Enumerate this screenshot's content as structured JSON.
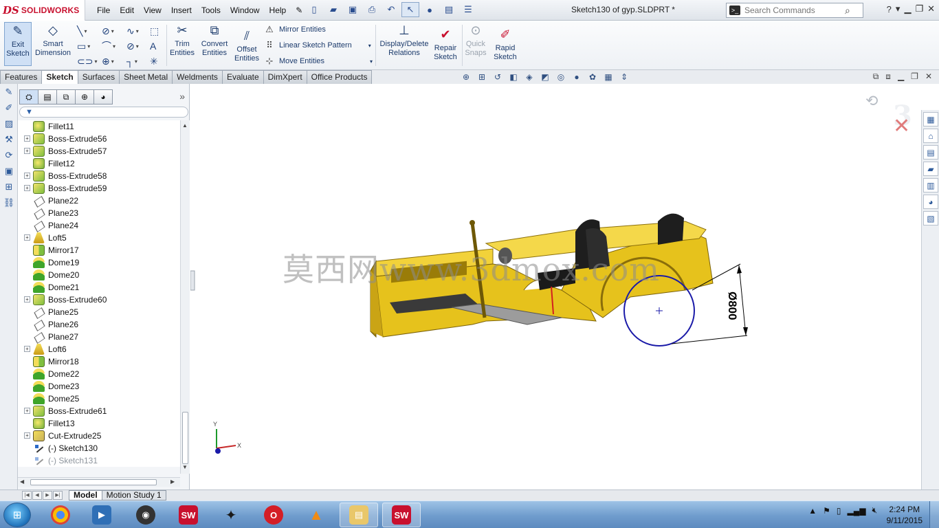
{
  "app": {
    "brand_mark": "DS",
    "brand_name": "SOLIDWORKS",
    "window_title": "Sketch130 of gyp.SLDPRT *"
  },
  "menu": [
    "File",
    "Edit",
    "View",
    "Insert",
    "Tools",
    "Window",
    "Help"
  ],
  "search": {
    "placeholder": "Search Commands"
  },
  "ribbon": {
    "exit_sketch": "Exit\nSketch",
    "smart_dimension": "Smart\nDimension",
    "trim_entities": "Trim\nEntities",
    "convert_entities": "Convert\nEntities",
    "offset_entities": "Offset\nEntities",
    "mirror_entities": "Mirror Entities",
    "linear_sketch_pattern": "Linear Sketch Pattern",
    "move_entities": "Move Entities",
    "display_delete_relations": "Display/Delete\nRelations",
    "repair_sketch": "Repair\nSketch",
    "quick_snaps": "Quick\nSnaps",
    "rapid_sketch": "Rapid\nSketch"
  },
  "tabs": [
    {
      "label": "Features",
      "active": false
    },
    {
      "label": "Sketch",
      "active": true
    },
    {
      "label": "Surfaces",
      "active": false
    },
    {
      "label": "Sheet Metal",
      "active": false
    },
    {
      "label": "Weldments",
      "active": false
    },
    {
      "label": "Evaluate",
      "active": false
    },
    {
      "label": "DimXpert",
      "active": false
    },
    {
      "label": "Office Products",
      "active": false
    }
  ],
  "tree": [
    {
      "label": "Fillet11",
      "type": "fillet",
      "expandable": false
    },
    {
      "label": "Boss-Extrude56",
      "type": "boss",
      "expandable": true
    },
    {
      "label": "Boss-Extrude57",
      "type": "boss",
      "expandable": true
    },
    {
      "label": "Fillet12",
      "type": "fillet",
      "expandable": false
    },
    {
      "label": "Boss-Extrude58",
      "type": "boss",
      "expandable": true
    },
    {
      "label": "Boss-Extrude59",
      "type": "boss",
      "expandable": true
    },
    {
      "label": "Plane22",
      "type": "plane",
      "expandable": false
    },
    {
      "label": "Plane23",
      "type": "plane",
      "expandable": false
    },
    {
      "label": "Plane24",
      "type": "plane",
      "expandable": false
    },
    {
      "label": "Loft5",
      "type": "loft",
      "expandable": true
    },
    {
      "label": "Mirror17",
      "type": "mirror",
      "expandable": false
    },
    {
      "label": "Dome19",
      "type": "dome",
      "expandable": false
    },
    {
      "label": "Dome20",
      "type": "dome",
      "expandable": false
    },
    {
      "label": "Dome21",
      "type": "dome",
      "expandable": false
    },
    {
      "label": "Boss-Extrude60",
      "type": "boss",
      "expandable": true
    },
    {
      "label": "Plane25",
      "type": "plane",
      "expandable": false
    },
    {
      "label": "Plane26",
      "type": "plane",
      "expandable": false
    },
    {
      "label": "Plane27",
      "type": "plane",
      "expandable": false
    },
    {
      "label": "Loft6",
      "type": "loft",
      "expandable": true
    },
    {
      "label": "Mirror18",
      "type": "mirror",
      "expandable": false
    },
    {
      "label": "Dome22",
      "type": "dome",
      "expandable": false
    },
    {
      "label": "Dome23",
      "type": "dome",
      "expandable": false
    },
    {
      "label": "Dome25",
      "type": "dome",
      "expandable": false
    },
    {
      "label": "Boss-Extrude61",
      "type": "boss",
      "expandable": true
    },
    {
      "label": "Fillet13",
      "type": "fillet",
      "expandable": false
    },
    {
      "label": "Cut-Extrude25",
      "type": "cut",
      "expandable": true
    },
    {
      "label": "(-) Sketch130",
      "type": "sketch",
      "expandable": false
    },
    {
      "label": "(-) Sketch131",
      "type": "sketch",
      "expandable": false,
      "dimmed": true
    }
  ],
  "viewport": {
    "watermark": "莫西网www.3dmox.com",
    "dimension": "Ø800",
    "triad_x": "X",
    "triad_y": "Y",
    "sketch_circle_color": "#1a1aa8",
    "body_color": "#e6c21c"
  },
  "bottom_tabs": [
    {
      "label": "Model",
      "active": true
    },
    {
      "label": "Motion Study 1",
      "active": false
    }
  ],
  "taskbar": {
    "apps": [
      "chrome-icon",
      "media-player-icon",
      "disk-utility-icon",
      "solidworks-icon",
      "3d-app-icon",
      "opera-icon",
      "vlc-icon",
      "file-explorer-icon",
      "solidworks-active-icon"
    ],
    "time": "2:24 PM",
    "date": "9/11/2015"
  }
}
